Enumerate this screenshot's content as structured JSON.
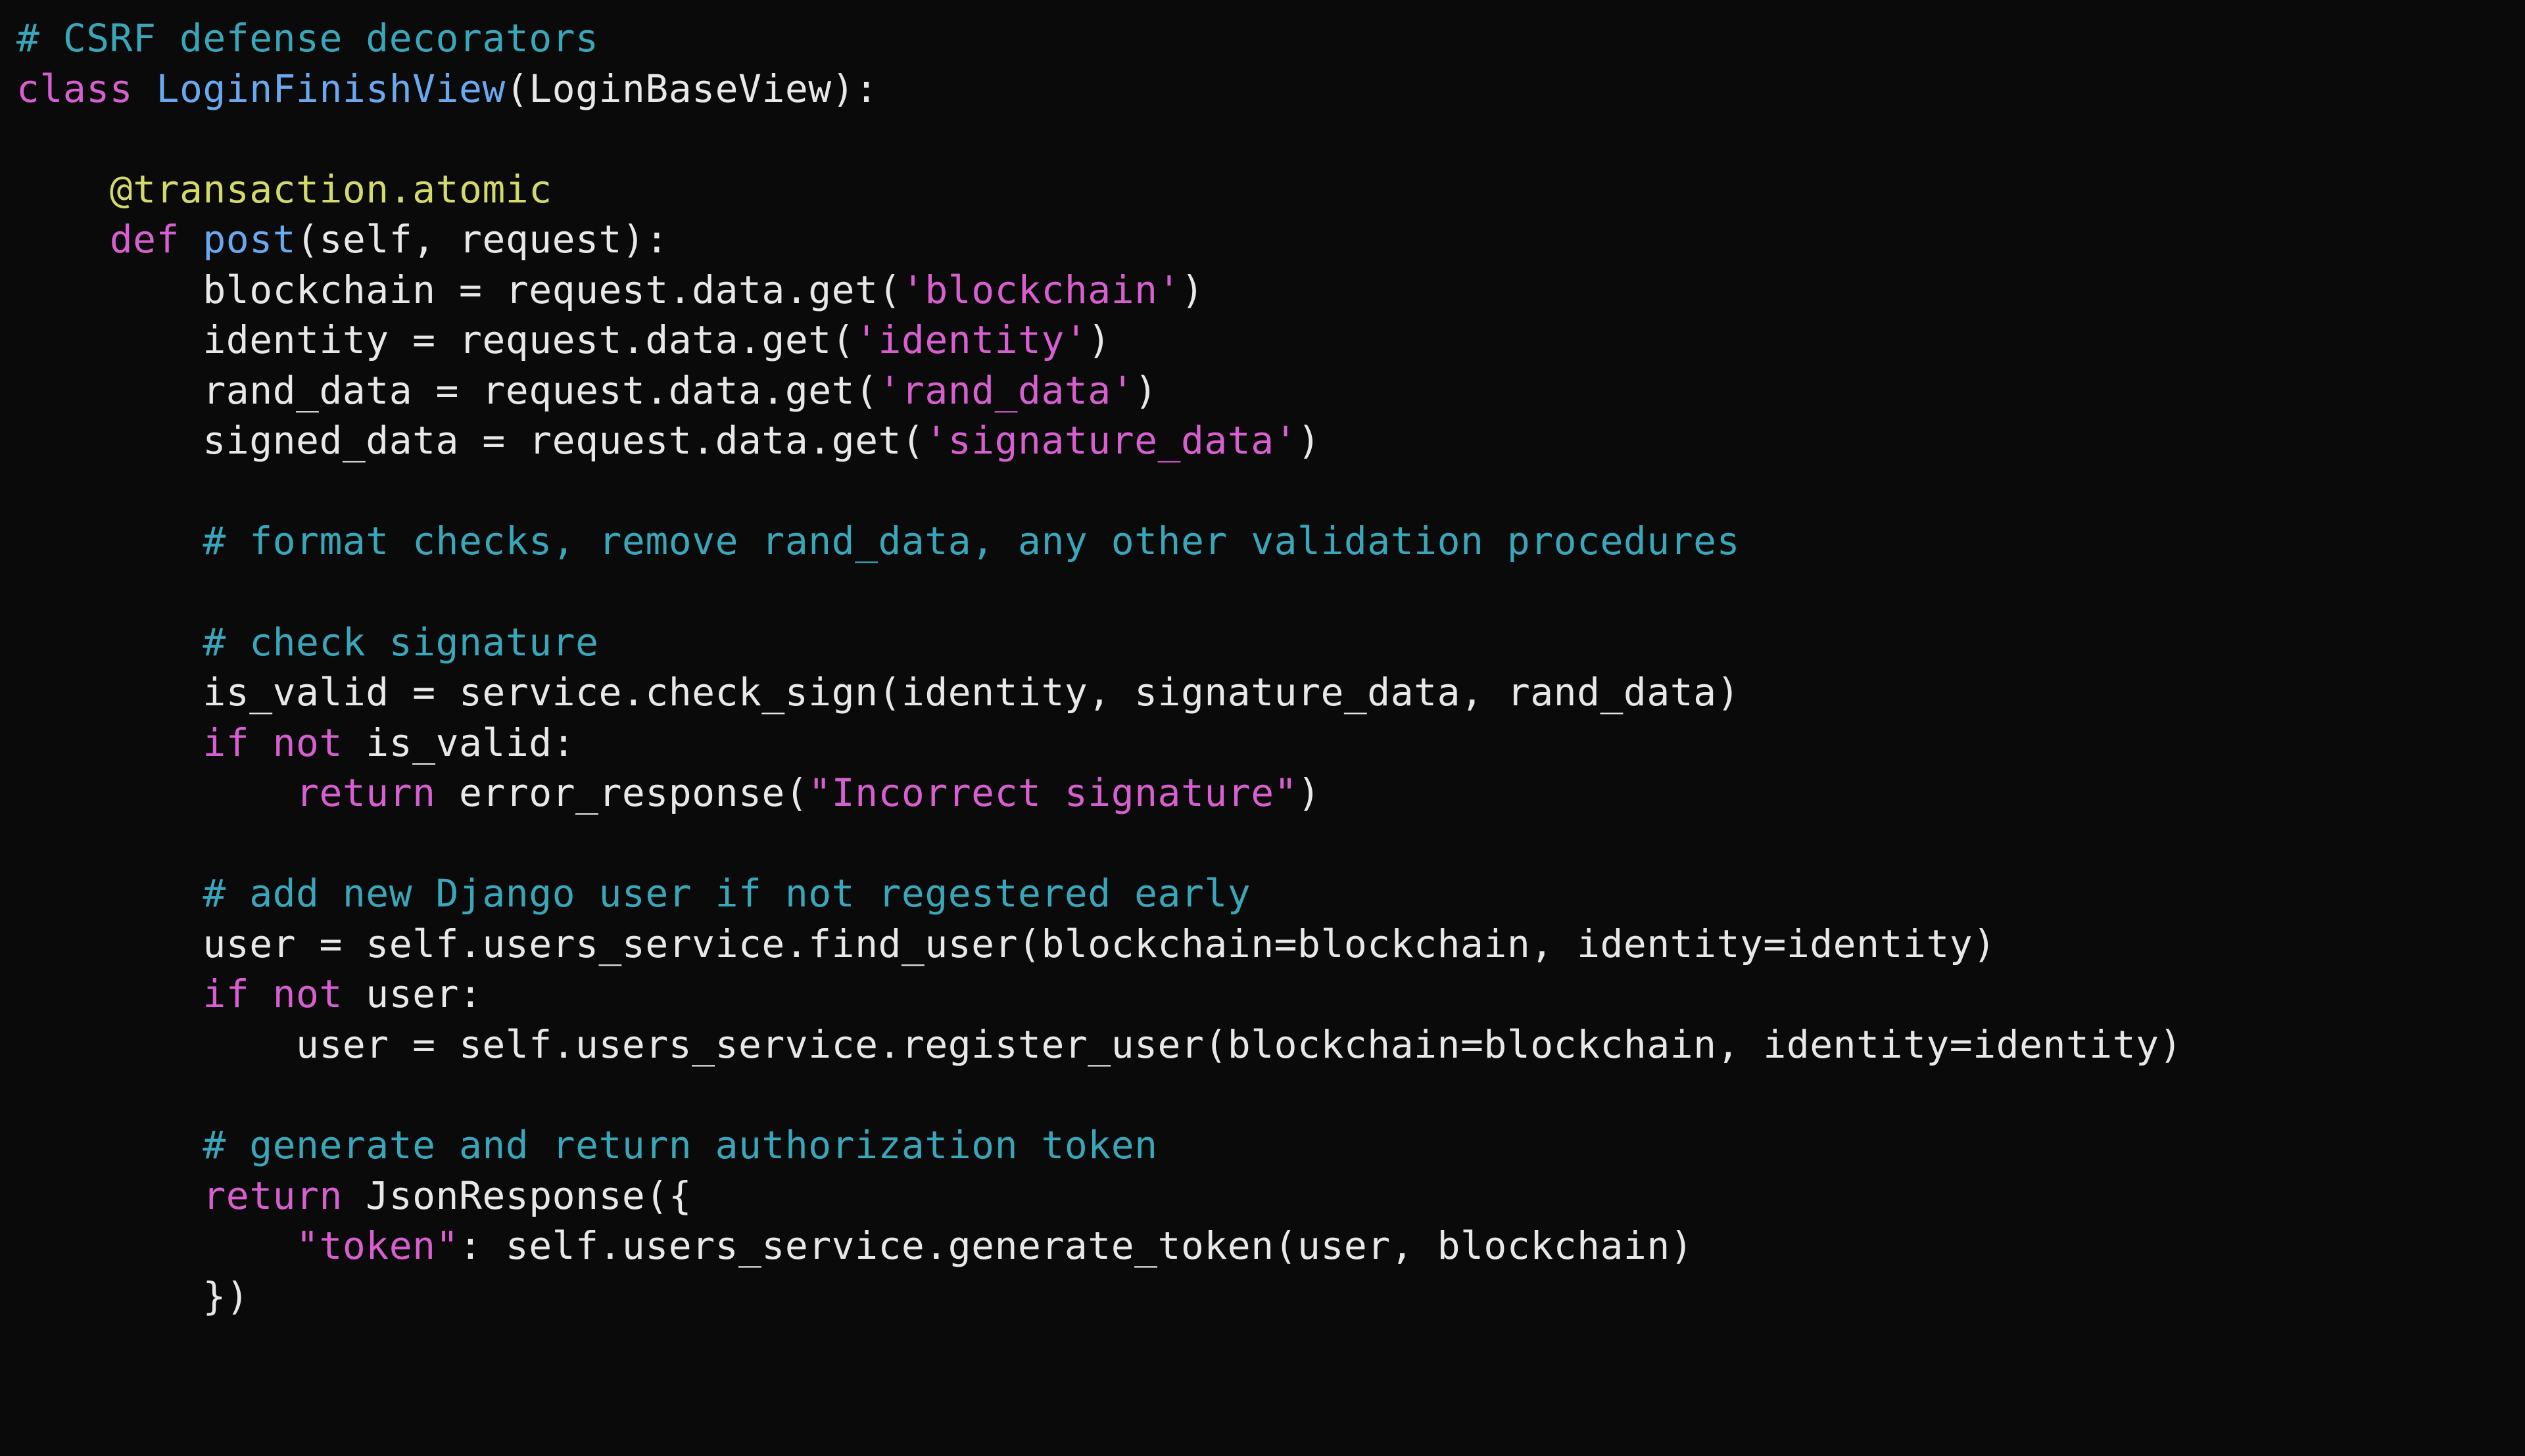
{
  "code": {
    "l1_comment": "# CSRF defense decorators",
    "l2_kw_class": "class",
    "l2_classname": "LoginFinishView",
    "l2_baseclass": "LoginBaseView",
    "l4_decorator": "@transaction.atomic",
    "l5_kw_def": "def",
    "l5_fn": "post",
    "l5_params": "(self, request):",
    "l6_lhs": "blockchain = request.data.get(",
    "l6_str": "'blockchain'",
    "l6_rhs": ")",
    "l7_lhs": "identity = request.data.get(",
    "l7_str": "'identity'",
    "l7_rhs": ")",
    "l8_lhs": "rand_data = request.data.get(",
    "l8_str": "'rand_data'",
    "l8_rhs": ")",
    "l9_lhs": "signed_data = request.data.get(",
    "l9_str": "'signature_data'",
    "l9_rhs": ")",
    "l11_comment": "# format checks, remove rand_data, any other validation procedures",
    "l13_comment": "# check signature",
    "l14": "is_valid = service.check_sign(identity, signature_data, rand_data)",
    "l15_kw_if": "if",
    "l15_kw_not": "not",
    "l15_rest": " is_valid:",
    "l16_kw_return": "return",
    "l16_call": " error_response(",
    "l16_str": "\"Incorrect signature\"",
    "l16_close": ")",
    "l18_comment": "# add new Django user if not regestered early",
    "l19": "user = self.users_service.find_user(blockchain=blockchain, identity=identity)",
    "l20_kw_if": "if",
    "l20_kw_not": "not",
    "l20_rest": " user:",
    "l21": "user = self.users_service.register_user(blockchain=blockchain, identity=identity)",
    "l23_comment": "# generate and return authorization token",
    "l24_kw_return": "return",
    "l24_call": " JsonResponse({",
    "l25_str": "\"token\"",
    "l25_rest": ": self.users_service.generate_token(user, blockchain)",
    "l26": "})"
  }
}
